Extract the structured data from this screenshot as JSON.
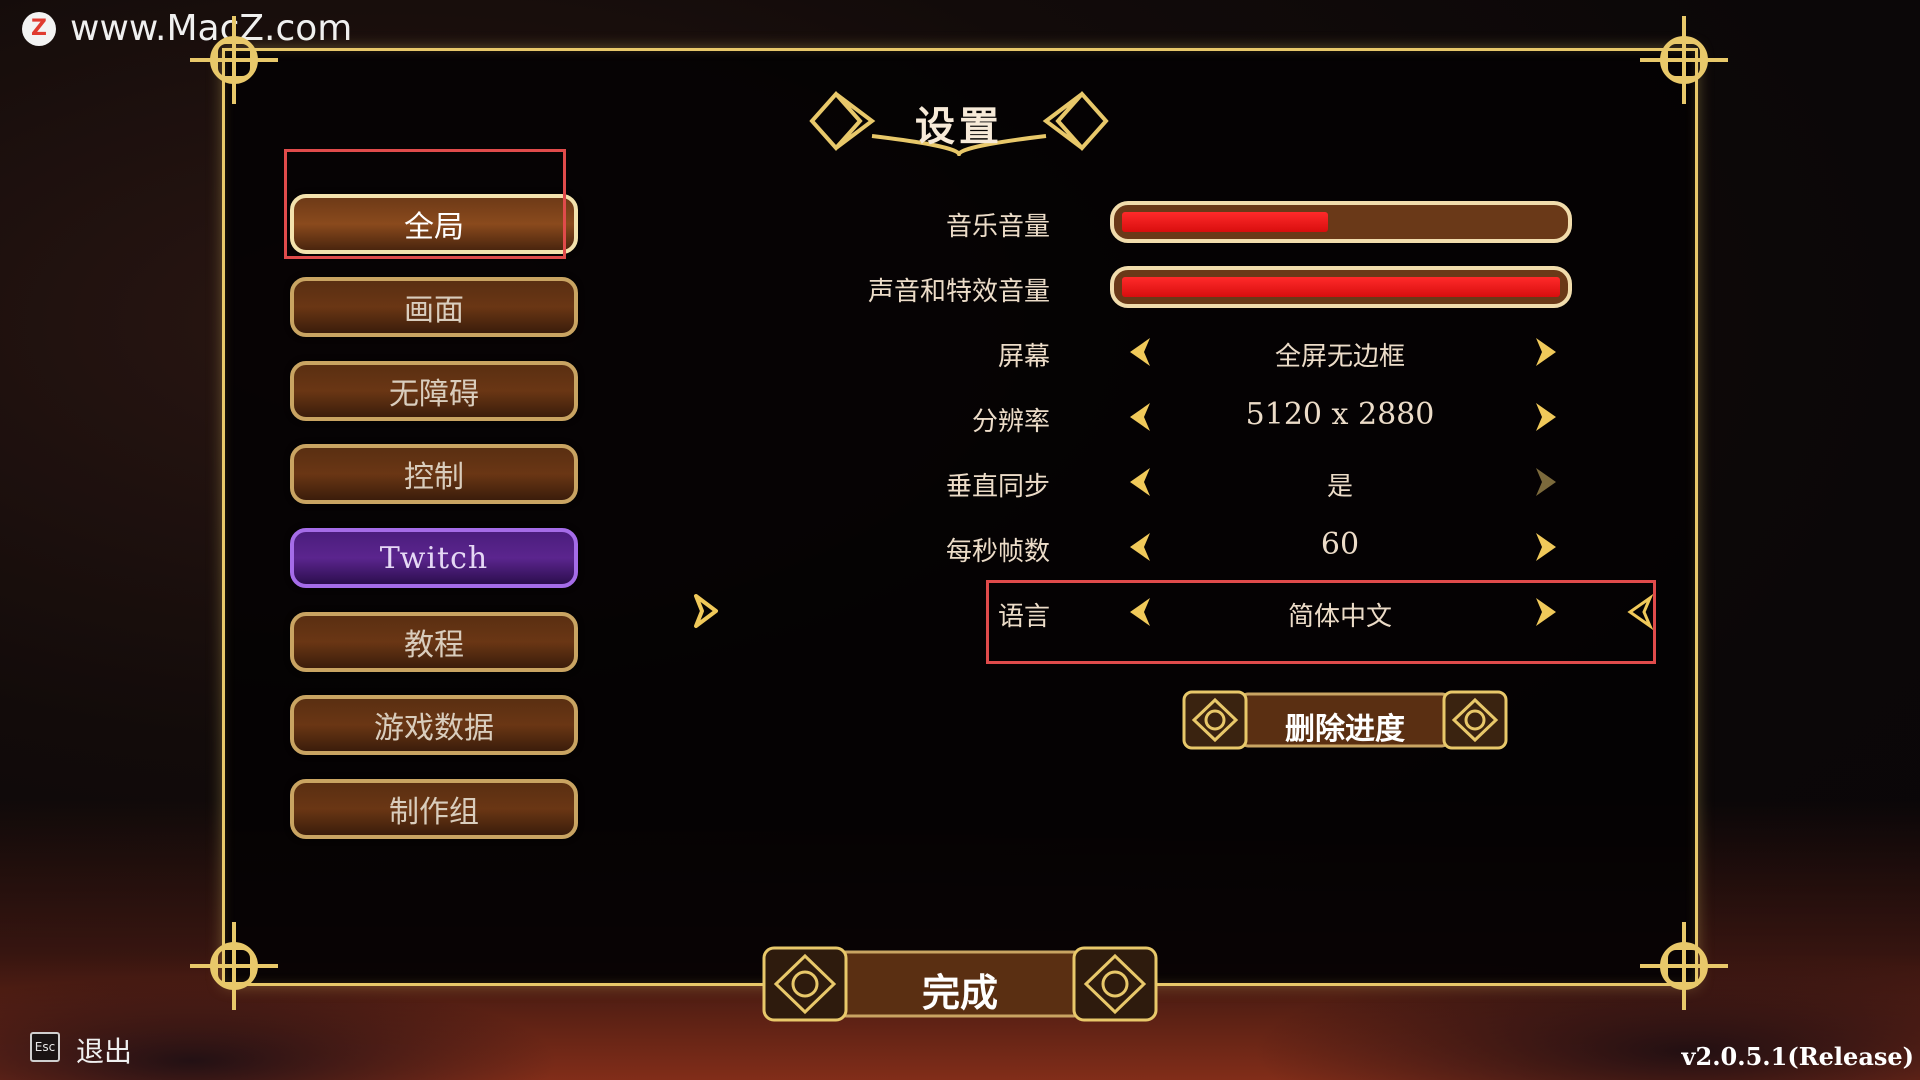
{
  "watermark": {
    "icon": "Z",
    "text": "www.MacZ.com"
  },
  "title": "设置",
  "menu": [
    {
      "label": "全局",
      "state": "active"
    },
    {
      "label": "画面",
      "state": "normal"
    },
    {
      "label": "无障碍",
      "state": "normal"
    },
    {
      "label": "控制",
      "state": "normal"
    },
    {
      "label": "Twitch",
      "state": "twitch"
    },
    {
      "label": "教程",
      "state": "normal"
    },
    {
      "label": "游戏数据",
      "state": "normal"
    },
    {
      "label": "制作组",
      "state": "normal"
    }
  ],
  "settings": {
    "music_volume": {
      "label": "音乐音量",
      "value_fraction": 0.47
    },
    "sfx_volume": {
      "label": "声音和特效音量",
      "value_fraction": 1.0
    },
    "screen": {
      "label": "屏幕",
      "value": "全屏无边框"
    },
    "resolution": {
      "label": "分辨率",
      "value": "5120 x 2880"
    },
    "vsync": {
      "label": "垂直同步",
      "value": "是"
    },
    "fps": {
      "label": "每秒帧数",
      "value": "60"
    },
    "language": {
      "label": "语言",
      "value": "简体中文"
    }
  },
  "delete_progress_label": "删除进度",
  "done_label": "完成",
  "footer": {
    "esc_key": "Esc",
    "exit_label": "退出",
    "version": "v2.0.5.1(Release)"
  },
  "colors": {
    "gold": "#e8c86a",
    "slider_red": "#ff1a1a",
    "twitch_purple": "#5b258e",
    "highlight_box": "#e04b4b"
  }
}
